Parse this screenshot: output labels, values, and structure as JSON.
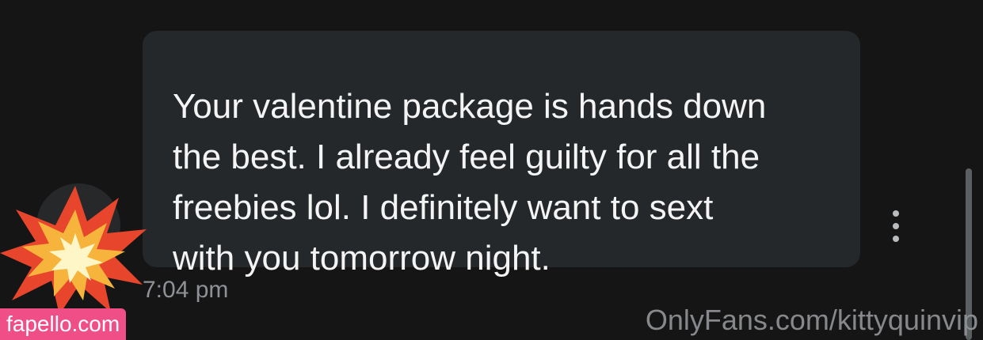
{
  "message": {
    "text": "Your valentine package is hands down\nthe best. I already feel guilty for all the\nfreebies lol. I definitely want to sext\nwith you tomorrow night.",
    "timestamp": "7:04 pm"
  },
  "overlays": {
    "left_watermark": "fapello.com",
    "right_watermark": "OnlyFans.com/kittyquinvip",
    "sticker_icon": "collision-burst-icon"
  },
  "colors": {
    "background": "#151516",
    "bubble": "#25282b",
    "text": "#f4f4f4",
    "timestamp": "#8e9297",
    "watermark_bg": "#ef4f86"
  }
}
